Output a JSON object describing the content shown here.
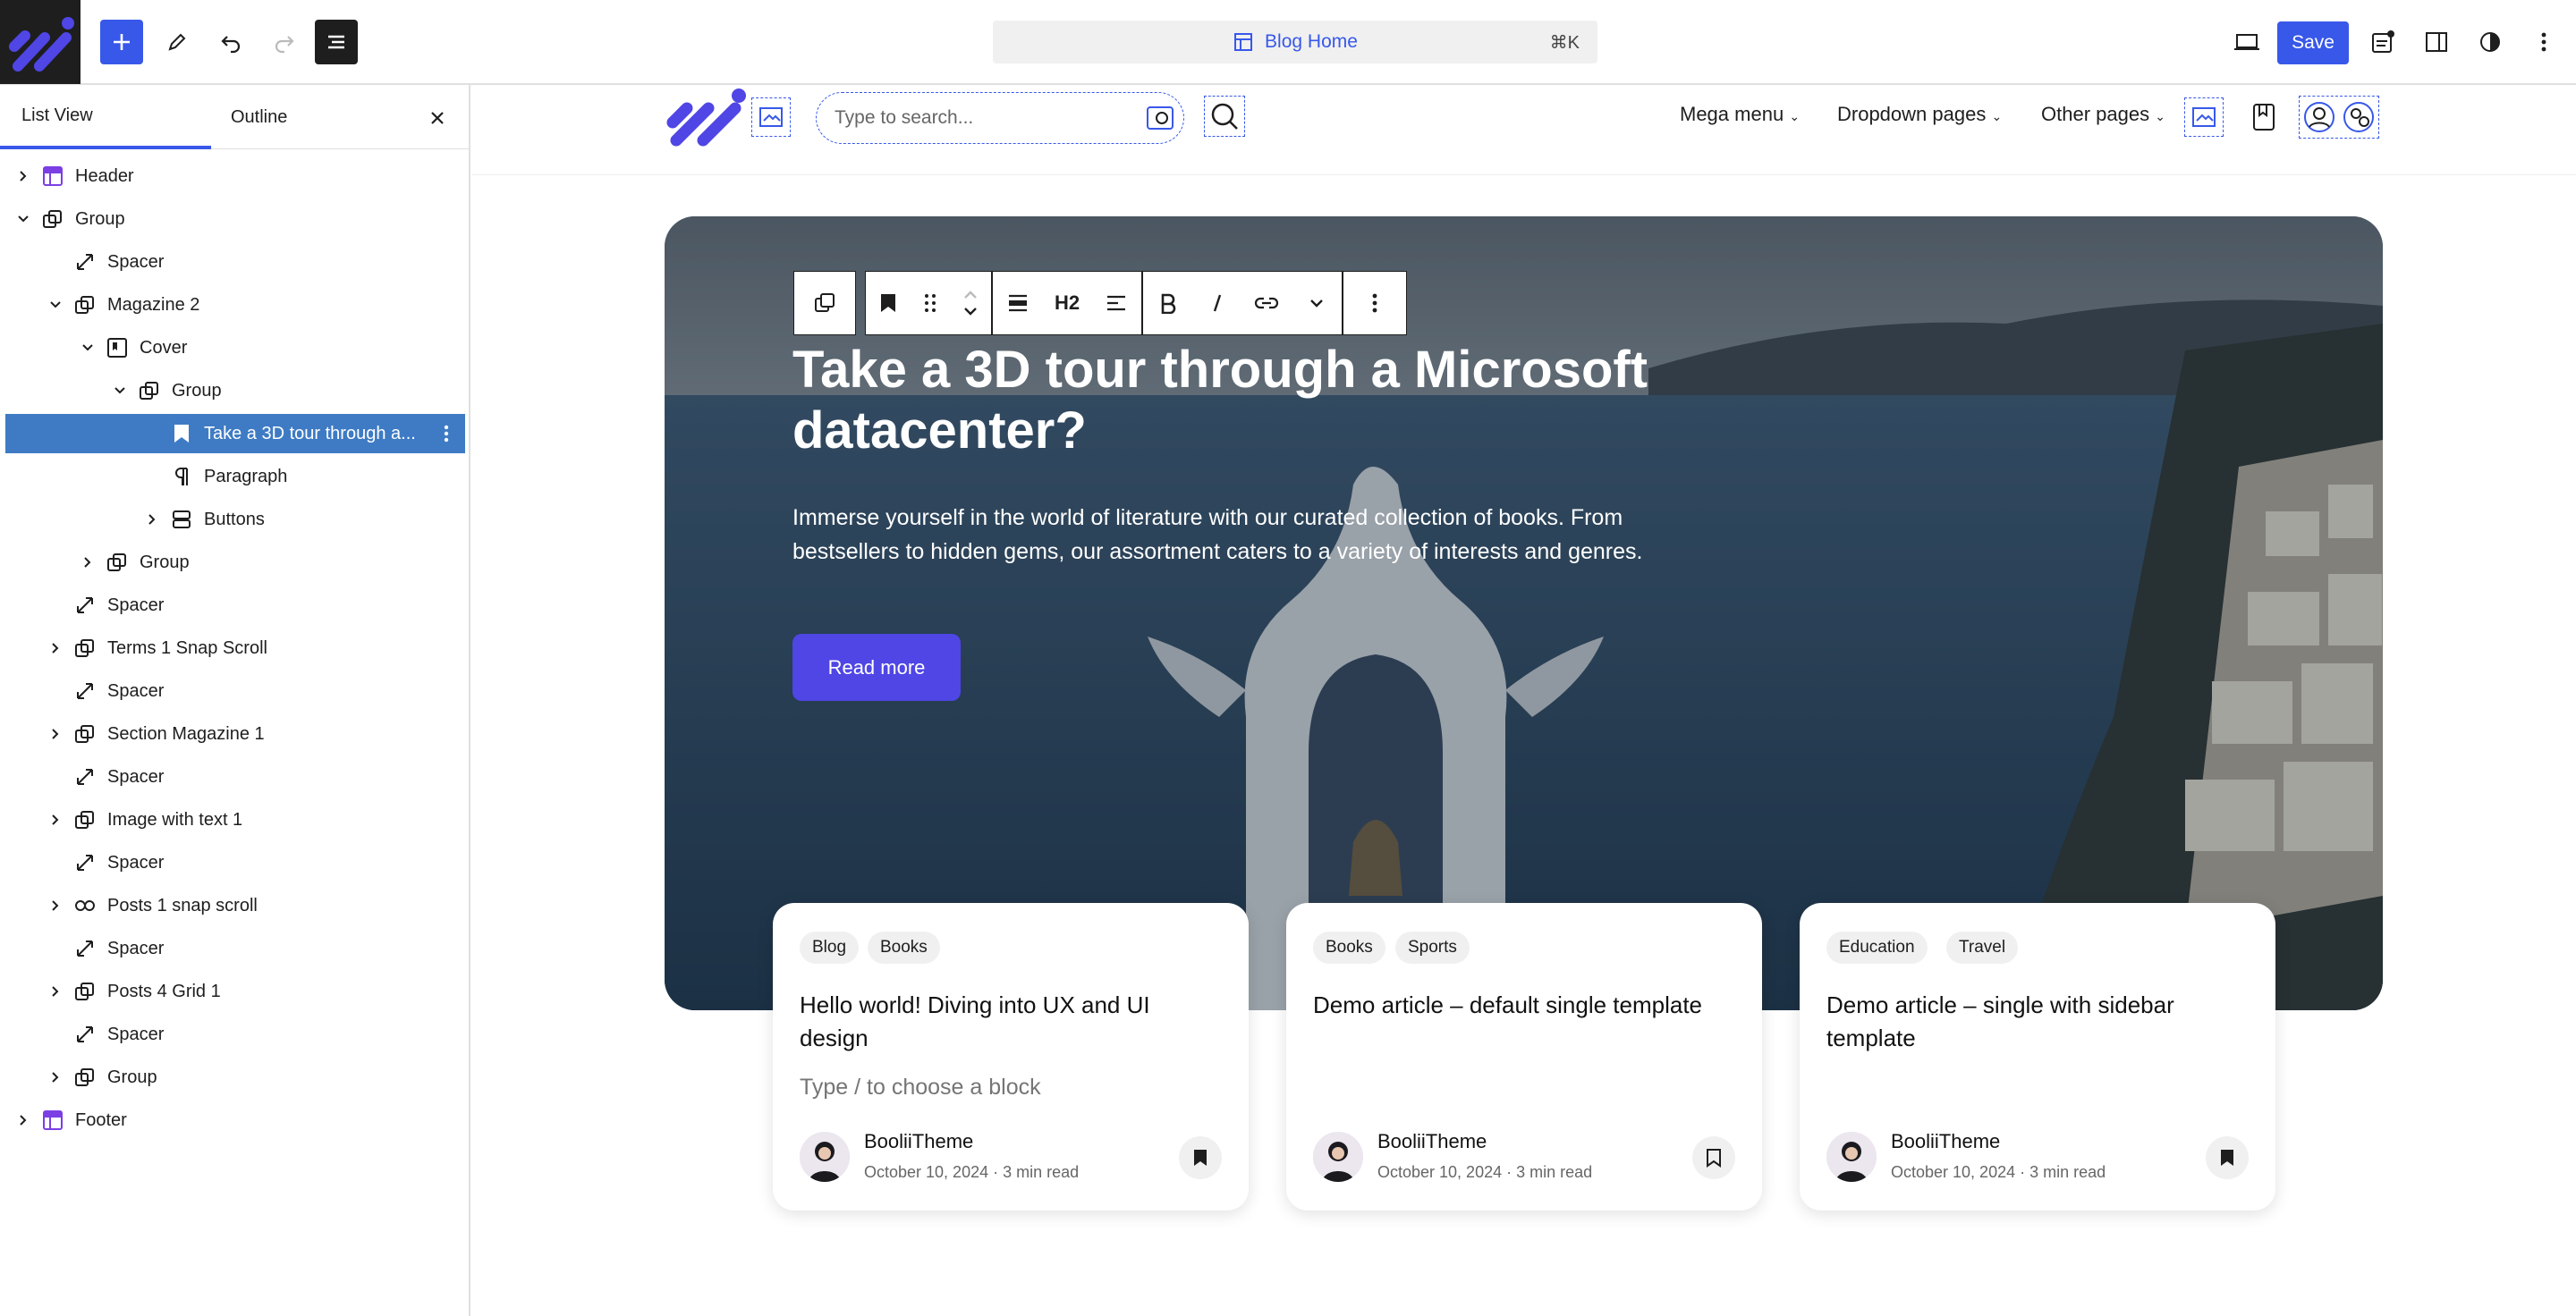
{
  "topbar": {
    "document_title": "Blog Home",
    "shortcut": "⌘K",
    "save_label": "Save"
  },
  "sidebar": {
    "tabs": [
      "List View",
      "Outline"
    ],
    "items": [
      {
        "label": "Header",
        "icon": "template-part-icon",
        "depth": 0,
        "expand": "collapsed"
      },
      {
        "label": "Group",
        "icon": "group-icon",
        "depth": 0,
        "expand": "expanded"
      },
      {
        "label": "Spacer",
        "icon": "spacer-icon",
        "depth": 1,
        "expand": "none"
      },
      {
        "label": "Magazine 2",
        "icon": "group-icon",
        "depth": 1,
        "expand": "expanded"
      },
      {
        "label": "Cover",
        "icon": "cover-icon",
        "depth": 2,
        "expand": "expanded"
      },
      {
        "label": "Group",
        "icon": "group-icon",
        "depth": 3,
        "expand": "expanded"
      },
      {
        "label": "Take a 3D tour through a...",
        "icon": "heading-icon",
        "depth": 4,
        "expand": "none",
        "selected": true
      },
      {
        "label": "Paragraph",
        "icon": "paragraph-icon",
        "depth": 4,
        "expand": "none"
      },
      {
        "label": "Buttons",
        "icon": "buttons-icon",
        "depth": 4,
        "expand": "collapsed"
      },
      {
        "label": "Group",
        "icon": "group-icon",
        "depth": 2,
        "expand": "collapsed"
      },
      {
        "label": "Spacer",
        "icon": "spacer-icon",
        "depth": 1,
        "expand": "none"
      },
      {
        "label": "Terms 1 Snap Scroll",
        "icon": "group-icon",
        "depth": 1,
        "expand": "collapsed"
      },
      {
        "label": "Spacer",
        "icon": "spacer-icon",
        "depth": 1,
        "expand": "none"
      },
      {
        "label": "Section Magazine 1",
        "icon": "group-icon",
        "depth": 1,
        "expand": "collapsed"
      },
      {
        "label": "Spacer",
        "icon": "spacer-icon",
        "depth": 1,
        "expand": "none"
      },
      {
        "label": "Image with text 1",
        "icon": "group-icon",
        "depth": 1,
        "expand": "collapsed"
      },
      {
        "label": "Spacer",
        "icon": "spacer-icon",
        "depth": 1,
        "expand": "none"
      },
      {
        "label": "Posts 1 snap scroll",
        "icon": "loop-icon",
        "depth": 1,
        "expand": "collapsed"
      },
      {
        "label": "Spacer",
        "icon": "spacer-icon",
        "depth": 1,
        "expand": "none"
      },
      {
        "label": "Posts 4 Grid 1",
        "icon": "group-icon",
        "depth": 1,
        "expand": "collapsed"
      },
      {
        "label": "Spacer",
        "icon": "spacer-icon",
        "depth": 1,
        "expand": "none"
      },
      {
        "label": "Group",
        "icon": "group-icon",
        "depth": 1,
        "expand": "collapsed"
      },
      {
        "label": "Footer",
        "icon": "template-part-icon",
        "depth": 0,
        "expand": "collapsed"
      }
    ]
  },
  "site_header": {
    "search_placeholder": "Type to search...",
    "nav": [
      "Mega menu",
      "Dropdown pages",
      "Other pages"
    ]
  },
  "block_toolbar": {
    "heading_level": "H2"
  },
  "hero": {
    "heading": "Take a 3D tour through a Microsoft datacenter?",
    "paragraph": "Immerse yourself in the world of literature with our curated collection of books. From bestsellers to hidden gems, our assortment caters to a variety of interests and genres.",
    "button": "Read more"
  },
  "cards": [
    {
      "tags": [
        "Blog",
        "Books"
      ],
      "title": "Hello world! Diving into UX and UI design",
      "placeholder": "Type / to choose a block",
      "author": "BooliiTheme",
      "date": "October 10, 2024",
      "read": "3 min read",
      "bookmarked": true
    },
    {
      "tags": [
        "Books",
        "Sports"
      ],
      "title": "Demo article – default single template",
      "placeholder": "",
      "author": "BooliiTheme",
      "date": "October 10, 2024",
      "read": "3 min read",
      "bookmarked": false
    },
    {
      "tags": [
        "Education",
        "Travel"
      ],
      "title": "Demo article – single with sidebar template",
      "placeholder": "",
      "author": "BooliiTheme",
      "date": "October 10, 2024",
      "read": "3 min read",
      "bookmarked": true
    }
  ],
  "colors": {
    "wp_blue": "#3858e9",
    "selected_row": "#3e7bc4",
    "logo_purple": "#4f46e5",
    "read_more": "#4f46e5"
  }
}
